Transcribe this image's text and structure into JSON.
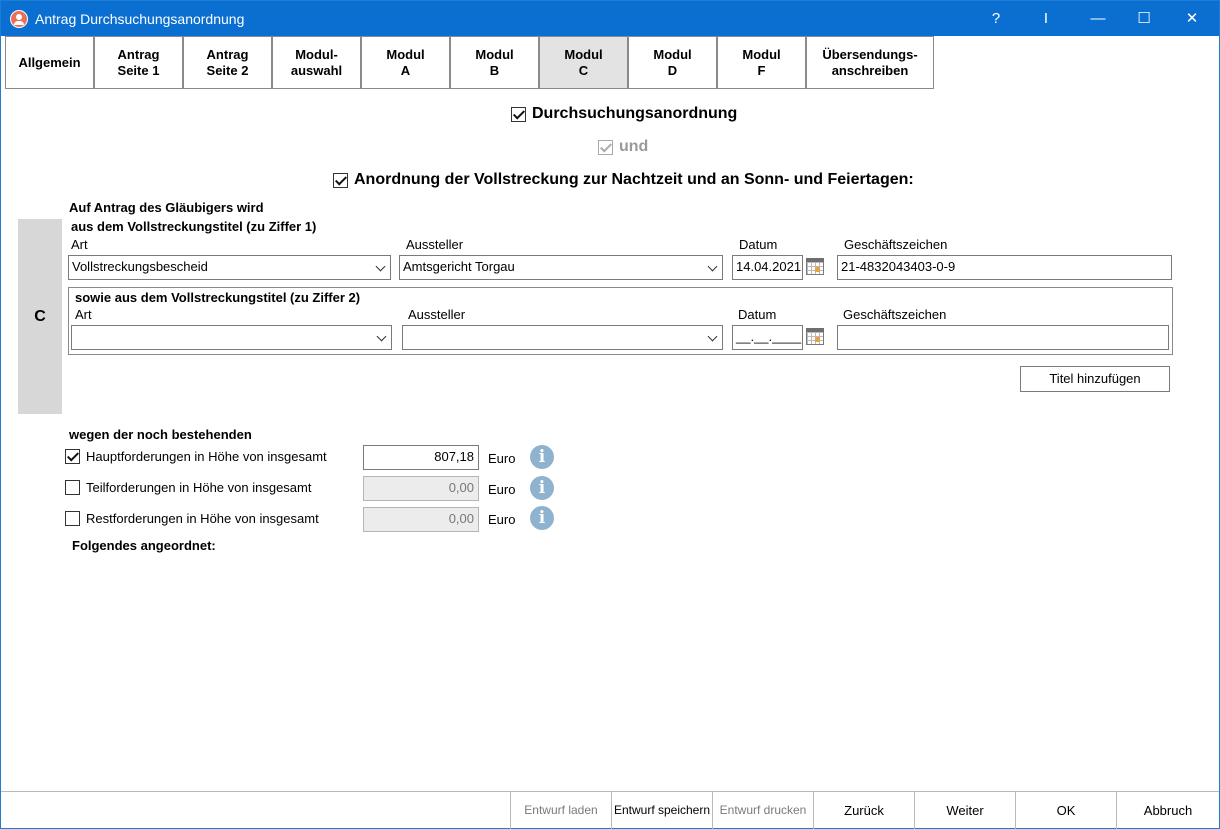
{
  "window": {
    "title": "Antrag Durchsuchungsanordnung",
    "help": "?",
    "cursor": "I",
    "minimize": "—",
    "maximize": "☐",
    "close": "✕"
  },
  "tabs": [
    {
      "label": "Allgemein"
    },
    {
      "label": "Antrag\nSeite 1"
    },
    {
      "label": "Antrag\nSeite 2"
    },
    {
      "label": "Modul-\nauswahl"
    },
    {
      "label": "Modul\nA"
    },
    {
      "label": "Modul\nB"
    },
    {
      "label": "Modul\nC"
    },
    {
      "label": "Modul\nD"
    },
    {
      "label": "Modul\nF"
    },
    {
      "label": "Übersendungs-\nanschreiben"
    }
  ],
  "header": {
    "durchsuchung": "Durchsuchungsanordnung",
    "und": "und",
    "anordnung": "Anordnung der Vollstreckung zur Nachtzeit und an Sonn- und Feiertagen:"
  },
  "side_label": "C",
  "section": {
    "intro": "Auf Antrag des Gläubigers wird",
    "title1": "aus dem Vollstreckungstitel (zu Ziffer 1)",
    "title2": "sowie aus dem Vollstreckungstitel (zu Ziffer 2)"
  },
  "columns": {
    "art": "Art",
    "aussteller": "Aussteller",
    "datum": "Datum",
    "geschaeftszeichen": "Geschäftszeichen"
  },
  "titel1": {
    "art": "Vollstreckungsbescheid",
    "aussteller": "Amtsgericht Torgau",
    "datum": "14.04.2021",
    "geschaeftszeichen": "21-4832043403-0-9"
  },
  "titel2": {
    "art": "",
    "aussteller": "",
    "datum": "__.__.____",
    "geschaeftszeichen": ""
  },
  "add_title_button": "Titel hinzufügen",
  "forderungen": {
    "heading": "wegen der noch bestehenden",
    "rows": [
      {
        "label": "Hauptforderungen in Höhe von insgesamt",
        "value": "807,18",
        "unit": "Euro",
        "info": "i"
      },
      {
        "label": "Teilforderungen in Höhe von insgesamt",
        "value": "0,00",
        "unit": "Euro",
        "info": "i"
      },
      {
        "label": "Restforderungen in Höhe von insgesamt",
        "value": "0,00",
        "unit": "Euro",
        "info": "i"
      }
    ],
    "footer": "Folgendes angeordnet:"
  },
  "footer": {
    "entwurf_laden": "Entwurf laden",
    "entwurf_speichern": "Entwurf speichern",
    "entwurf_drucken": "Entwurf drucken",
    "zurueck": "Zurück",
    "weiter": "Weiter",
    "ok": "OK",
    "abbruch": "Abbruch"
  }
}
